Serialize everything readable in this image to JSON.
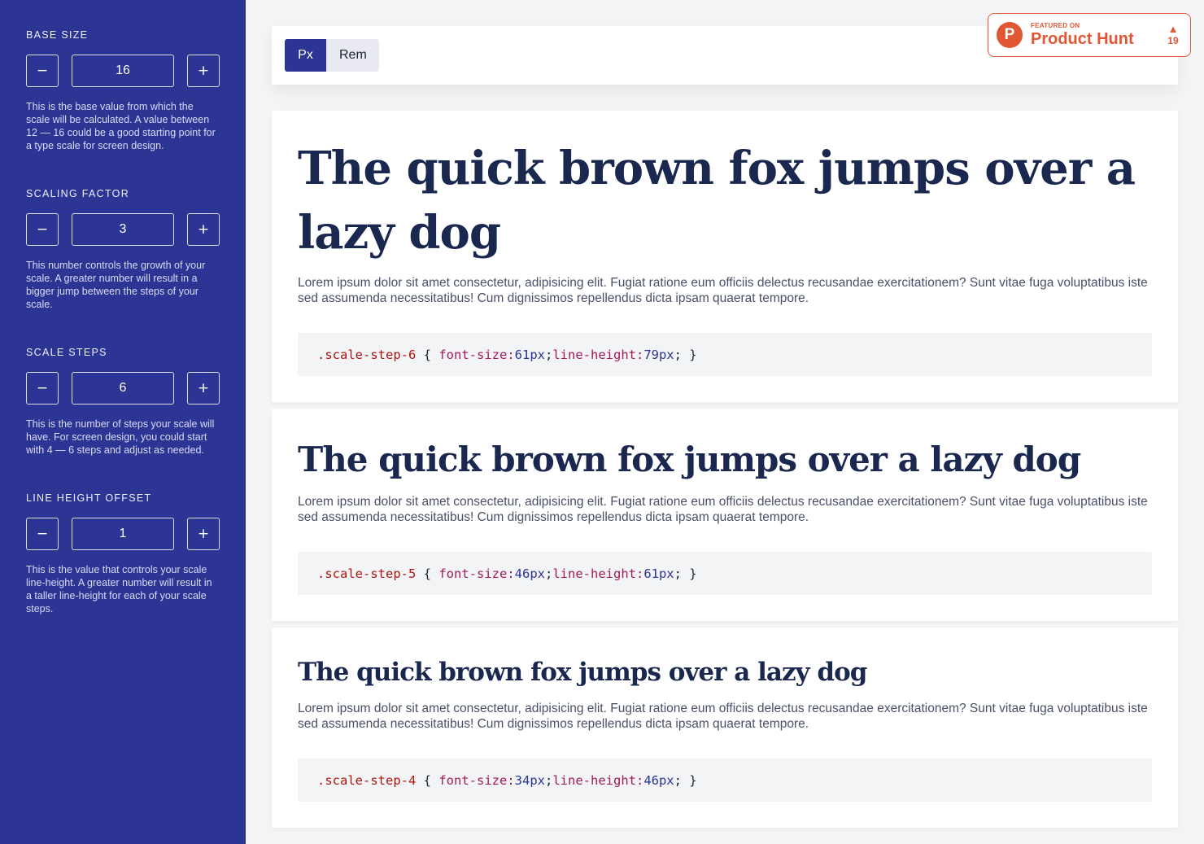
{
  "sidebar": {
    "controls": [
      {
        "label": "BASE SIZE",
        "value": "16",
        "decrement": "−",
        "increment": "+",
        "description": "This is the base value from which the scale will be calculated. A value between 12 — 16 could be a good starting point for a type scale for screen design."
      },
      {
        "label": "SCALING FACTOR",
        "value": "3",
        "decrement": "−",
        "increment": "+",
        "description": "This number controls the growth of your scale. A greater number will result in a bigger jump between the steps of your scale."
      },
      {
        "label": "SCALE STEPS",
        "value": "6",
        "decrement": "−",
        "increment": "+",
        "description": "This is the number of steps your scale will have. For screen design, you could start with 4 — 6 steps and adjust as needed."
      },
      {
        "label": "LINE HEIGHT OFFSET",
        "value": "1",
        "decrement": "−",
        "increment": "+",
        "description": "This is the value that controls your scale line-height. A greater number will result in a taller line-height for each of your scale steps."
      }
    ]
  },
  "units": {
    "px_label": "Px",
    "rem_label": "Rem",
    "selected": "Px"
  },
  "badge": {
    "featured": "FEATURED ON",
    "name": "Product Hunt",
    "logo_letter": "P",
    "arrow": "▲",
    "votes": "19"
  },
  "steps": [
    {
      "sample": "The quick brown fox jumps over a lazy dog",
      "lorem": "Lorem ipsum dolor sit amet consectetur, adipisicing elit. Fugiat ratione eum officiis delectus recusandae exercitationem? Sunt vitae fuga voluptatibus iste sed assumenda necessitatibus! Cum dignissimos repellendus dicta ipsam quaerat tempore.",
      "selector": ".scale-step-6",
      "font_size": "61px",
      "line_height": "79px"
    },
    {
      "sample": "The quick brown fox jumps over a lazy dog",
      "lorem": "Lorem ipsum dolor sit amet consectetur, adipisicing elit. Fugiat ratione eum officiis delectus recusandae exercitationem? Sunt vitae fuga voluptatibus iste sed assumenda necessitatibus! Cum dignissimos repellendus dicta ipsam quaerat tempore.",
      "selector": ".scale-step-5",
      "font_size": "46px",
      "line_height": "61px"
    },
    {
      "sample": "The quick brown fox jumps over a lazy dog",
      "lorem": "Lorem ipsum dolor sit amet consectetur, adipisicing elit. Fugiat ratione eum officiis delectus recusandae exercitationem? Sunt vitae fuga voluptatibus iste sed assumenda necessitatibus! Cum dignissimos repellendus dicta ipsam quaerat tempore.",
      "selector": ".scale-step-4",
      "font_size": "34px",
      "line_height": "46px"
    }
  ],
  "code_tokens": {
    "open": " { ",
    "prop_font": "font-size:",
    "prop_line": "line-height:",
    "semicolon": ";",
    "close": "; }"
  },
  "colors": {
    "sidebar_bg": "#2c3494",
    "heading": "#1a2850",
    "selector": "#b0140f",
    "property": "#a3195b",
    "value": "#2c3494",
    "badge_accent": "#e05734"
  }
}
